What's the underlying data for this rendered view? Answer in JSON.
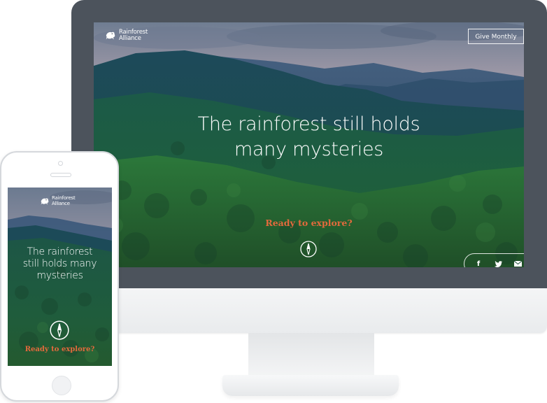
{
  "brand": {
    "name": "Rainforest Alliance",
    "line1": "Rainforest",
    "line2": "Alliance"
  },
  "desktop": {
    "give_button_label": "Give Monthly",
    "headline_line1": "The rainforest still holds",
    "headline_line2": "many mysteries",
    "cta_label": "Ready to explore?",
    "social": [
      {
        "icon": "facebook-icon",
        "glyph": "f"
      },
      {
        "icon": "twitter-icon",
        "glyph": "♥"
      },
      {
        "icon": "email-icon",
        "glyph": "✉"
      }
    ]
  },
  "mobile": {
    "headline_line1": "The rainforest",
    "headline_line2": "still holds many",
    "headline_line3": "mysteries",
    "cta_label": "Ready to explore?"
  },
  "colors": {
    "accent": "#e36a3c",
    "monitor_bezel": "#4c535c",
    "forest": "#1e4d3a"
  },
  "icons": {
    "logo": "frog-logo-icon",
    "compass": "compass-icon"
  }
}
